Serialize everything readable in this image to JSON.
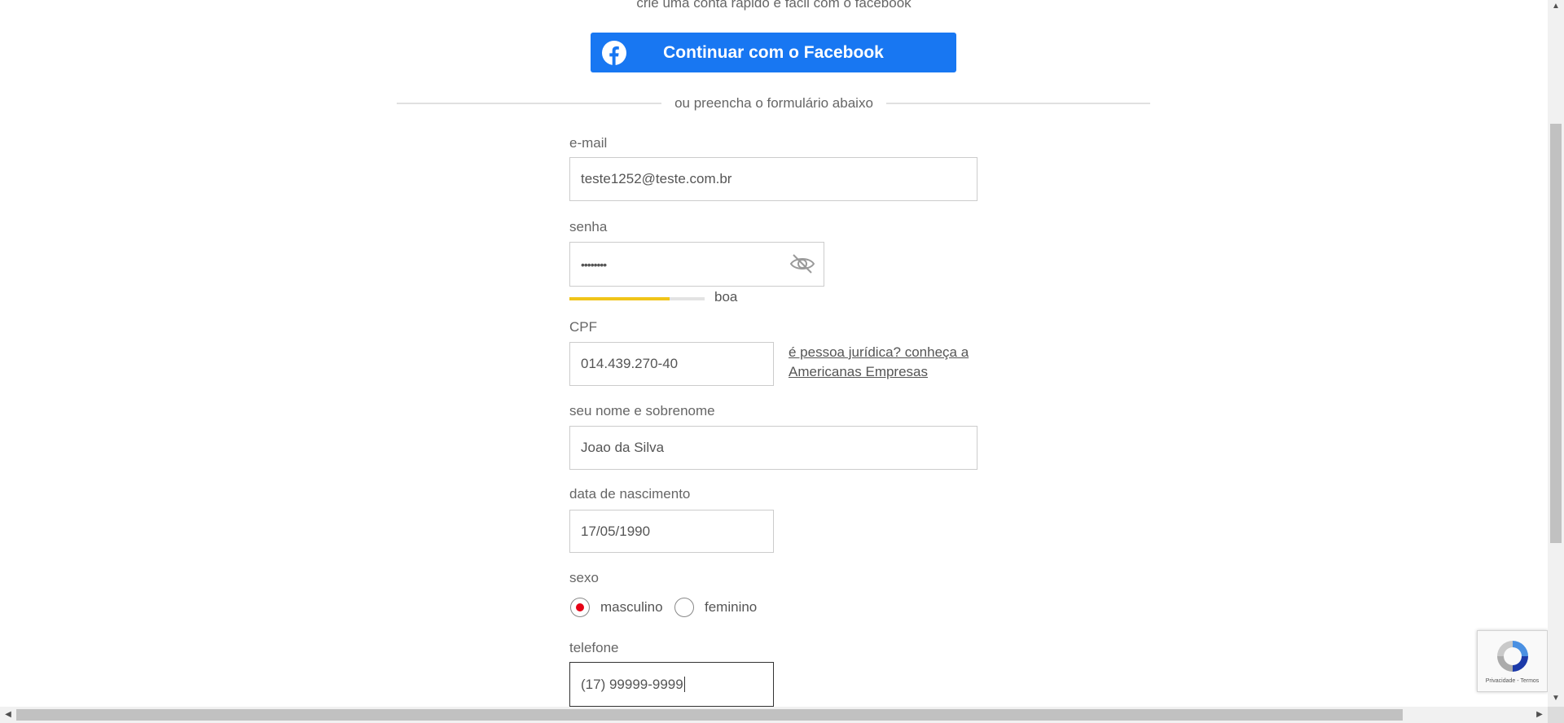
{
  "header": {
    "subtitle": "crie uma conta rápido e fácil com o facebook",
    "facebook_button": "Continuar com o Facebook",
    "divider_text": "ou preencha o formulário abaixo"
  },
  "form": {
    "email": {
      "label": "e-mail",
      "value": "teste1252@teste.com.br"
    },
    "password": {
      "label": "senha",
      "value": "••••••••",
      "strength_label": "boa",
      "strength_level": 0.74
    },
    "cpf": {
      "label": "CPF",
      "value": "014.439.270-40",
      "link_text": "é pessoa jurídica? conheça a Americanas Empresas"
    },
    "name": {
      "label": "seu nome e sobrenome",
      "value": "Joao da Silva"
    },
    "birthdate": {
      "label": "data de nascimento",
      "value": "17/05/1990"
    },
    "gender": {
      "label": "sexo",
      "options": [
        "masculino",
        "feminino"
      ],
      "selected": "masculino"
    },
    "phone": {
      "label": "telefone",
      "value": "(17) 99999-9999"
    }
  },
  "recaptcha": {
    "footer": "Privacidade - Termos"
  },
  "colors": {
    "facebook": "#1877f2",
    "strength": "#f0c419",
    "radio_selected": "#e60014"
  },
  "icons": [
    "facebook-icon",
    "eye-slash-icon",
    "recaptcha-icon"
  ]
}
